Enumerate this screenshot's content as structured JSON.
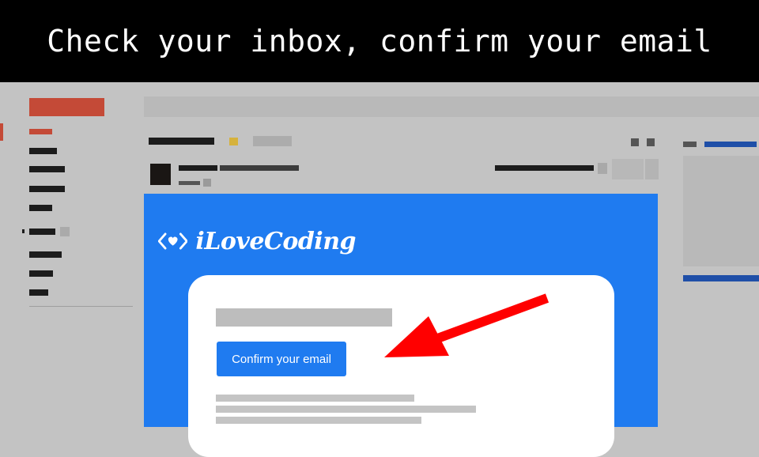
{
  "banner": {
    "caption": "Check your inbox, confirm your email"
  },
  "email": {
    "brand_name": "iLoveCoding",
    "confirm_button_label": "Confirm your email"
  },
  "colors": {
    "gmail_accent": "#d14836",
    "brand_blue": "#1f7bf0",
    "arrow_red": "#ff0000"
  },
  "icons": {
    "logo": "code-brackets-heart-icon",
    "pointer": "red-arrow-annotation"
  }
}
